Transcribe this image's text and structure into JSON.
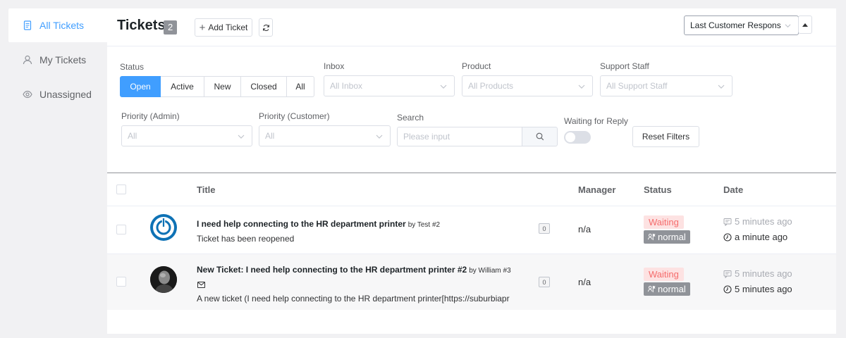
{
  "sidebar": {
    "items": [
      {
        "label": "All Tickets",
        "icon": "document-icon",
        "active": true
      },
      {
        "label": "My Tickets",
        "icon": "user-icon",
        "active": false
      },
      {
        "label": "Unassigned",
        "icon": "eye-icon",
        "active": false
      }
    ]
  },
  "header": {
    "title": "Tickets",
    "count": "2",
    "add_label": "Add Ticket",
    "sort_value": "Last Customer Respons"
  },
  "filters": {
    "status_label": "Status",
    "status_options": [
      "Open",
      "Active",
      "New",
      "Closed",
      "All"
    ],
    "status_selected": "Open",
    "inbox_label": "Inbox",
    "inbox_placeholder": "All Inbox",
    "product_label": "Product",
    "product_placeholder": "All Products",
    "staff_label": "Support Staff",
    "staff_placeholder": "All Support Staff",
    "prio_admin_label": "Priority (Admin)",
    "prio_admin_placeholder": "All",
    "prio_customer_label": "Priority (Customer)",
    "prio_customer_placeholder": "All",
    "search_label": "Search",
    "search_placeholder": "Please input",
    "waiting_label": "Waiting for Reply",
    "reset_label": "Reset Filters"
  },
  "table": {
    "columns": {
      "title": "Title",
      "manager": "Manager",
      "status": "Status",
      "date": "Date"
    },
    "rows": [
      {
        "title": "I need help connecting to the HR department printer",
        "by": "by Test #2",
        "subtitle": "Ticket has been reopened",
        "replies": "0",
        "manager": "n/a",
        "status": "Waiting",
        "priority": "normal",
        "date_created": "5 minutes ago",
        "date_updated": "a minute ago"
      },
      {
        "title": "New Ticket: I need help connecting to the HR department printer #2",
        "by": "by William #3",
        "subtitle": "A new ticket (I need help connecting to the HR department printer[https://suburbiapr",
        "replies": "0",
        "manager": "n/a",
        "status": "Waiting",
        "priority": "normal",
        "date_created": "5 minutes ago",
        "date_updated": "5 minutes ago"
      }
    ]
  },
  "colors": {
    "accent": "#409eff",
    "waiting_bg": "#fde2e2",
    "waiting_text": "#f56c6c",
    "priority_bg": "#909399"
  }
}
